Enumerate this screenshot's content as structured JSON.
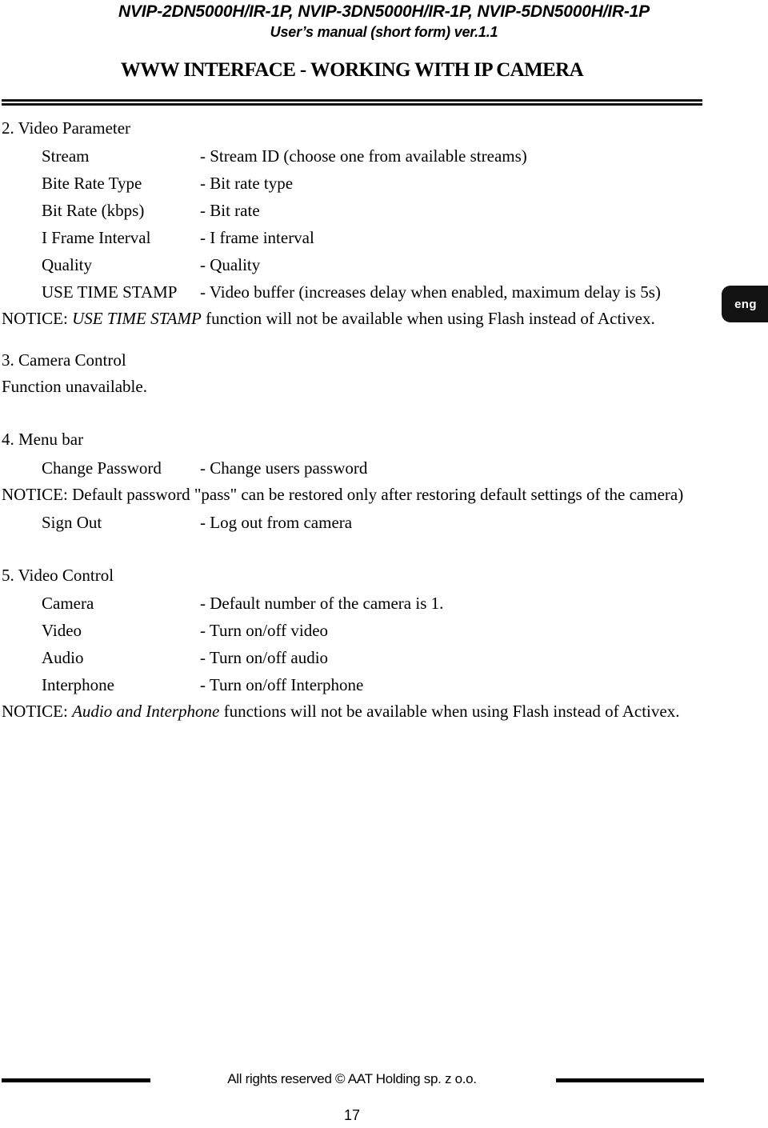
{
  "header": {
    "models": "NVIP-2DN5000H/IR-1P, NVIP-3DN5000H/IR-1P, NVIP-5DN5000H/IR-1P",
    "manual": "User’s manual (short form) ver.1.1",
    "section_title": "WWW INTERFACE - WORKING WITH IP CAMERA"
  },
  "language_tab": {
    "label": "eng",
    "background_color": "#131313",
    "text_color": "#ffffff"
  },
  "sections": [
    {
      "heading": "2.  Video Parameter",
      "rows": [
        {
          "term": "Stream",
          "desc": "- Stream ID (choose one from available streams)"
        },
        {
          "term": "Bite Rate Type",
          "desc": "- Bit rate type"
        },
        {
          "term": "Bit Rate (kbps)",
          "desc": "- Bit rate"
        },
        {
          "term": "I Frame Interval",
          "desc": "- I frame interval"
        },
        {
          "term": "Quality",
          "desc": "- Quality"
        },
        {
          "term": "USE TIME STAMP",
          "desc": "- Video buffer (increases delay when enabled, maximum delay is 5s)"
        }
      ],
      "notice": {
        "prefix": "NOTICE: ",
        "emphasis": "USE TIME STAMP",
        "suffix": " function will not be available when using Flash instead of Activex."
      }
    },
    {
      "heading": "3. Camera Control",
      "body": "Function unavailable."
    },
    {
      "heading": "4.  Menu bar",
      "rows_before_notice": [
        {
          "term": "Change Password",
          "desc": "- Change users password"
        }
      ],
      "notice_plain": "NOTICE: Default password \"pass\" can be restored only after restoring default settings of the camera)",
      "rows_after_notice": [
        {
          "term": "Sign Out",
          "desc": "- Log out from camera"
        }
      ]
    },
    {
      "heading": "5. Video Control",
      "rows": [
        {
          "term": "Camera",
          "desc": "- Default number of the camera is 1."
        },
        {
          "term": "Video",
          "desc": "- Turn on/off video"
        },
        {
          "term": "Audio",
          "desc": "- Turn on/off audio"
        },
        {
          "term": "Interphone",
          "desc": "- Turn on/off Interphone"
        }
      ],
      "notice": {
        "prefix": "NOTICE: ",
        "emphasis": "Audio and Interphone",
        "suffix": " functions will not be available when using Flash instead of Activex."
      }
    }
  ],
  "footer": {
    "copyright": "All rights reserved © AAT Holding sp. z o.o.",
    "page_number": "17"
  }
}
